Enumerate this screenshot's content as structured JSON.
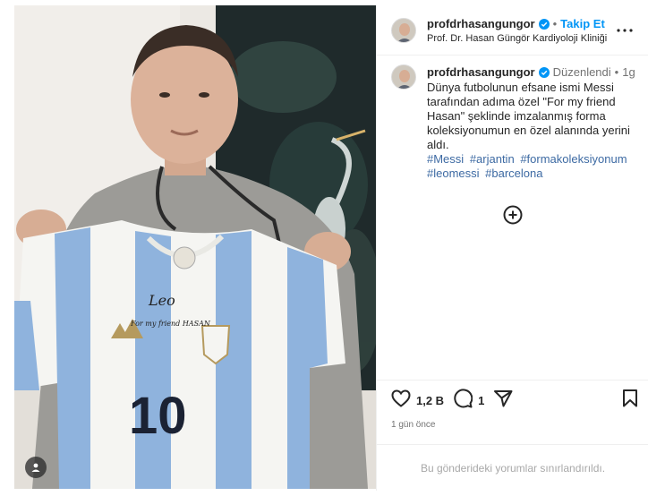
{
  "post": {
    "username": "profdrhasangungor",
    "follow_label": "Takip Et",
    "subtitle": "Prof. Dr. Hasan Güngör Kardiyoloji Kliniği",
    "edited_label": "Düzenlendi",
    "relative_time": "1g",
    "caption": "Dünya futbolunun efsane ismi Messi tarafından adıma özel \"For my friend Hasan\" şeklinde imzalanmış forma koleksiyonumun en özel alanında yerini aldı.",
    "hashtags": [
      "#Messi",
      "#arjantin",
      "#formakoleksiyonum",
      "#leomessi",
      "#barcelona"
    ],
    "like_count": "1,2 B",
    "comment_count": "1",
    "date_text": "1 gün önce",
    "comments_limited": "Bu gönderideki yorumlar sınırlandırıldı.",
    "jersey_number": "10",
    "jersey_signature": "For my friend HASAN",
    "jersey_sig_name": "Leo"
  },
  "icons": {
    "verified": "verified-badge-icon",
    "more": "more-options-icon",
    "load_more": "plus-circle-icon",
    "like": "heart-icon",
    "comment": "comment-icon",
    "share": "share-icon",
    "save": "bookmark-icon",
    "user_tag": "user-tag-icon"
  },
  "colors": {
    "accent": "#0095f6",
    "hashtag": "#3d6aa3",
    "muted": "#737373",
    "jersey_stripe": "#8fb3dd"
  }
}
